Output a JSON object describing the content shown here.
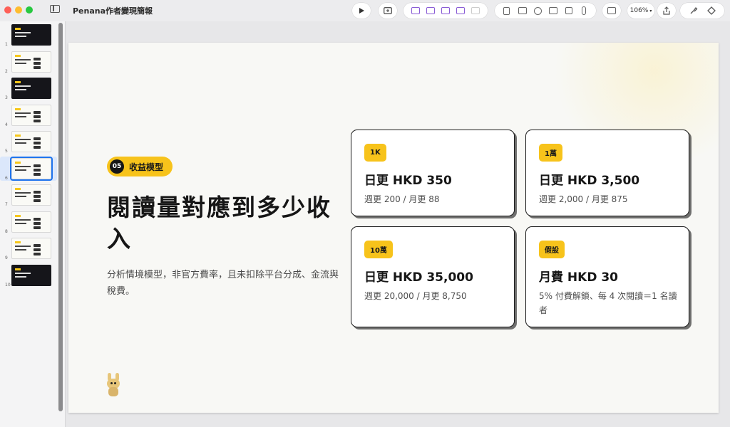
{
  "window": {
    "title": "Penana作者變現簡報",
    "zoom": "106%"
  },
  "slides": [
    {
      "num": "1",
      "theme": "dark"
    },
    {
      "num": "2",
      "theme": "light"
    },
    {
      "num": "3",
      "theme": "dark"
    },
    {
      "num": "4",
      "theme": "light"
    },
    {
      "num": "5",
      "theme": "light"
    },
    {
      "num": "6",
      "theme": "light",
      "active": true
    },
    {
      "num": "7",
      "theme": "light"
    },
    {
      "num": "8",
      "theme": "light"
    },
    {
      "num": "9",
      "theme": "light"
    },
    {
      "num": "10",
      "theme": "dark"
    }
  ],
  "slide": {
    "section_number": "05",
    "section_label": "收益模型",
    "title": "閱讀量對應到多少收入",
    "subtitle": "分析情境模型，非官方費率，且未扣除平台分成、金流與稅費。",
    "cards": [
      {
        "badge": "1K",
        "main": "日更 HKD 350",
        "detail": "週更 200  /  月更 88"
      },
      {
        "badge": "1萬",
        "main": "日更 HKD 3,500",
        "detail": "週更 2,000  /  月更 875"
      },
      {
        "badge": "10萬",
        "main": "日更 HKD 35,000",
        "detail": "週更 20,000  /  月更 8,750"
      },
      {
        "badge": "假設",
        "main": "月費 HKD 30",
        "detail": "5% 付費解鎖、每 4 次閱讀＝1 名讀者"
      }
    ]
  },
  "colors": {
    "accent": "#f7c31b",
    "selection": "#1f74ee",
    "slide_bg": "#f8f8f5"
  },
  "icons": [
    "play-icon",
    "add-slide-icon",
    "text-box-icon",
    "shape-icon",
    "media-icon",
    "image-icon",
    "table-icon",
    "chart-icon",
    "clock-icon",
    "screen-icon",
    "copy-icon",
    "attachment-icon",
    "comment-icon",
    "share-icon",
    "format-icon",
    "animate-icon"
  ]
}
